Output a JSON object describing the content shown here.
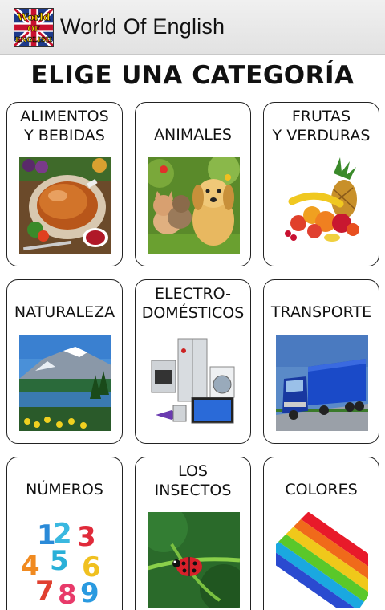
{
  "app": {
    "title": "World Of English",
    "icon_text": [
      "World",
      "OF",
      "ENGLISH"
    ]
  },
  "heading": "ELIGE UNA CATEGORÍA",
  "categories": [
    {
      "label": "ALIMENTOS\nY BEBIDAS",
      "icon": "food-image"
    },
    {
      "label": "ANIMALES",
      "icon": "animals-image"
    },
    {
      "label": "FRUTAS\nY VERDURAS",
      "icon": "fruits-image"
    },
    {
      "label": "NATURALEZA",
      "icon": "nature-image"
    },
    {
      "label": "ELECTRO-\nDOMÉSTICOS",
      "icon": "appliances-image"
    },
    {
      "label": "TRANSPORTE",
      "icon": "transport-image"
    },
    {
      "label": "NÚMEROS",
      "icon": "numbers-image"
    },
    {
      "label": "LOS\nINSECTOS",
      "icon": "insects-image"
    },
    {
      "label": "COLORES",
      "icon": "colors-image"
    }
  ],
  "colors": {
    "actionbar": "#e8e8e8",
    "card_border": "#222222"
  }
}
